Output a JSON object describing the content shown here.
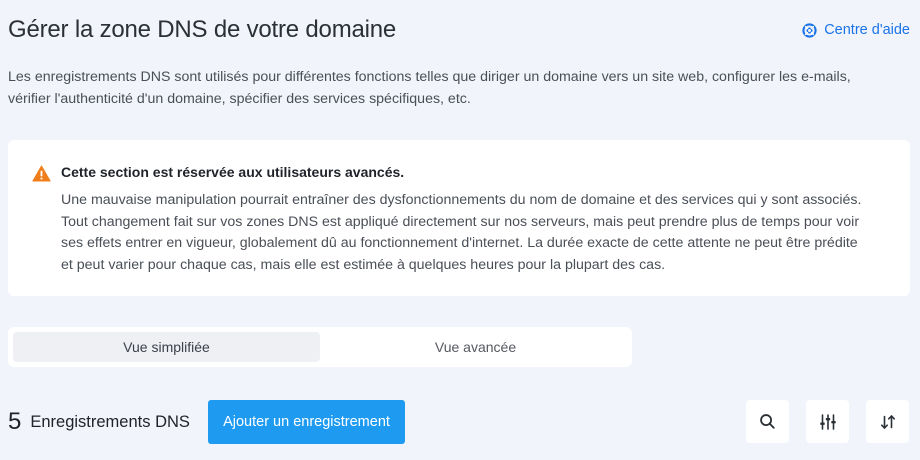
{
  "header": {
    "title": "Gérer la zone DNS de votre domaine",
    "help_label": "Centre d'aide"
  },
  "intro": {
    "line1": "Les enregistrements DNS sont utilisés pour différentes fonctions telles que diriger un domaine vers un site web, configurer les e-mails,",
    "line2": "vérifier l'authenticité d'un domaine, spécifier des services spécifiques, etc."
  },
  "warning": {
    "title": "Cette section est réservée aux utilisateurs avancés.",
    "lines": [
      "Une mauvaise manipulation pourrait entraîner des dysfonctionnements du nom de domaine et des services qui y sont associés.",
      "Tout changement fait sur vos zones DNS est appliqué directement sur nos serveurs, mais peut prendre plus de temps pour voir",
      "ses effets entrer en vigueur, globalement dû au fonctionnement d'internet. La durée exacte de cette attente ne peut être prédite",
      "et peut varier pour chaque cas, mais elle est estimée à quelques heures pour la plupart des cas."
    ],
    "icon": "warning-triangle-icon",
    "icon_color": "#f07d1a"
  },
  "view_toggle": {
    "simple_label": "Vue simplifiée",
    "advanced_label": "Vue avancée",
    "selected": "Vue simplifiée"
  },
  "records": {
    "count": "5",
    "label": "Enregistrements DNS",
    "add_label": "Ajouter un enregistrement"
  },
  "toolbar": {
    "icons": [
      "search-icon",
      "filter-sliders-icon",
      "sort-icon"
    ]
  },
  "colors": {
    "accent": "#1e9bf0",
    "link": "#1a73e8",
    "background": "#f1f4fa"
  }
}
